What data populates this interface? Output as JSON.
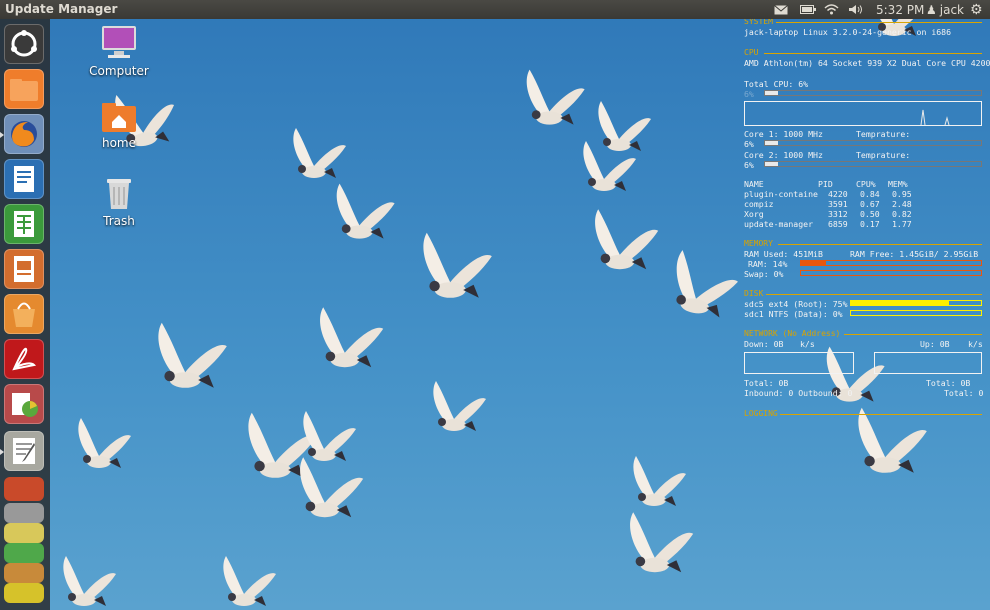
{
  "top_panel": {
    "app_title": "Update Manager",
    "indicators": {
      "mail_icon": "envelope-icon",
      "battery_icon": "battery-icon",
      "wifi_icon": "wifi-icon",
      "sound_icon": "speaker-icon",
      "clock": "5:32 PM",
      "user": "jack",
      "session_icon": "gear-icon"
    }
  },
  "launcher": {
    "items": [
      {
        "name": "Dash Home",
        "icon": "ubuntu-logo-icon"
      },
      {
        "name": "Home Folder",
        "icon": "folder-icon"
      },
      {
        "name": "Firefox",
        "icon": "firefox-icon"
      },
      {
        "name": "LibreOffice Writer",
        "icon": "writer-icon"
      },
      {
        "name": "LibreOffice Calc",
        "icon": "calc-icon"
      },
      {
        "name": "LibreOffice Impress",
        "icon": "impress-icon"
      },
      {
        "name": "Ubuntu Software Center",
        "icon": "software-center-icon"
      },
      {
        "name": "Adobe Reader",
        "icon": "pdf-reader-icon"
      },
      {
        "name": "System Monitor",
        "icon": "system-monitor-icon"
      },
      {
        "name": "Text Editor",
        "icon": "text-editor-icon"
      }
    ]
  },
  "desktop": {
    "icons": [
      {
        "label": "Computer",
        "icon": "computer-icon"
      },
      {
        "label": "home",
        "icon": "home-folder-icon"
      },
      {
        "label": "Trash",
        "icon": "trash-icon"
      }
    ]
  },
  "conky": {
    "system_header": "SYSTEM",
    "system_line": "jack-laptop Linux 3.2.0-24-generic on i686",
    "cpu_header": "CPU",
    "cpu_model": "AMD Athlon(tm) 64 Socket 939 X2 Dual Core CPU 4200+",
    "total_cpu": "Total CPU: 6%",
    "total_cpu_small": "6%",
    "total_cpu_level": 0.06,
    "core1": "Core 1: 1000 MHz",
    "core1_temp": "Temprature:",
    "core1_pct": "6%",
    "core1_level": 0.06,
    "core2": "Core 2: 1000 MHz",
    "core2_temp": "Temprature:",
    "core2_pct": "6%",
    "core2_level": 0.06,
    "proc_headers": [
      "NAME",
      "PID",
      "CPU%",
      "MEM%"
    ],
    "processes": [
      {
        "name": "plugin-containe",
        "pid": "4220",
        "cpu": "0.84",
        "mem": "0.95"
      },
      {
        "name": "compiz",
        "pid": "3591",
        "cpu": "0.67",
        "mem": "2.48"
      },
      {
        "name": "Xorg",
        "pid": "3312",
        "cpu": "0.50",
        "mem": "0.82"
      },
      {
        "name": "update-manager",
        "pid": "6859",
        "cpu": "0.17",
        "mem": "1.77"
      }
    ],
    "memory_header": "MEMORY",
    "ram_used": "RAM Used: 451MiB",
    "ram_free": "RAM Free: 1.45GiB/ 2.95GiB",
    "ram_pct": "RAM: 14%",
    "ram_level": 0.14,
    "swap": "Swap: 0%",
    "swap_level": 0,
    "disk_header": "DISK",
    "disk1": "sdc5 ext4 (Root): 75%",
    "disk1_level": 0.75,
    "disk2": "sdc1 NTFS (Data): 0%",
    "disk2_level": 0,
    "network_header": "NETWORK (No Address)",
    "down": "Down: 0B",
    "down_unit": "k/s",
    "up": "Up: 0B",
    "up_unit": "k/s",
    "total_left": "Total: 0B",
    "total_right": "Total: 0B",
    "inbound": "Inbound: 0 Outbound: 0",
    "total_conn": "Total: 0",
    "logging_header": "LOGGING",
    "colors": {
      "accent": "#d9a400",
      "ram_bar": "#e8570e",
      "disk_bar": "#ffef00"
    }
  }
}
